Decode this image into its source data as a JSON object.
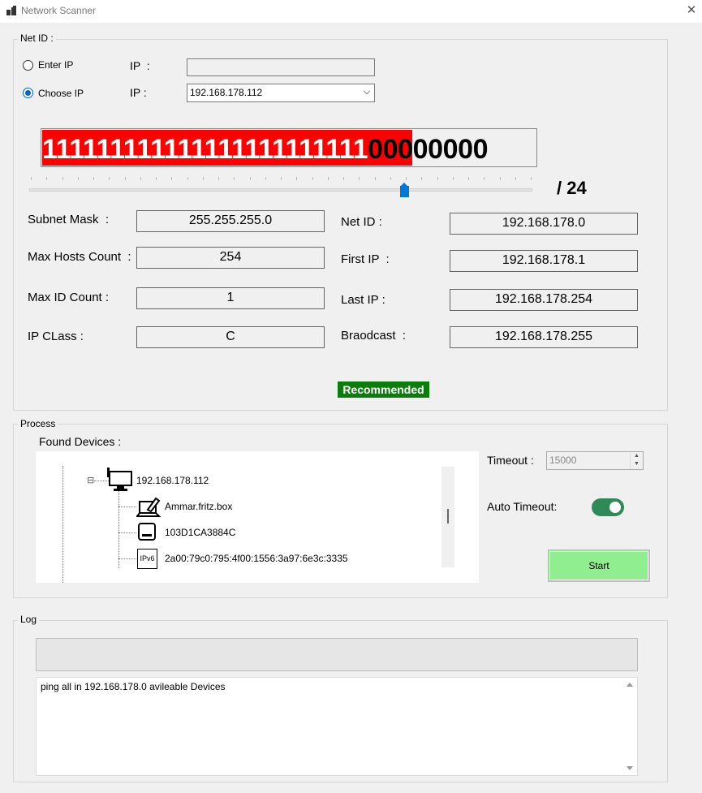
{
  "window": {
    "title": "Network Scanner",
    "close_symbol": "✕"
  },
  "netid_group": {
    "label": "Net ID :",
    "enter_ip": {
      "radio_label": "Enter IP",
      "ip_label": "IP  :",
      "value": "",
      "selected": false
    },
    "choose_ip": {
      "radio_label": "Choose IP",
      "ip_label": "IP :",
      "value": "192.168.178.112",
      "selected": true
    },
    "bits_ones": "111111111111111111111111",
    "bits_zeros": "00000000",
    "prefix": "/ 24",
    "slider_value": 24,
    "slider_max": 32
  },
  "fields_left": [
    {
      "label": "Subnet Mask  :",
      "value": "255.255.255.0"
    },
    {
      "label": "Max Hosts Count  :",
      "value": "254"
    },
    {
      "label": "Max ID Count :",
      "value": "1"
    },
    {
      "label": "IP CLass :",
      "value": "C"
    }
  ],
  "fields_right": [
    {
      "label": "Net ID :",
      "value": "192.168.178.0"
    },
    {
      "label": "First IP  :",
      "value": "192.168.178.1"
    },
    {
      "label": "Last IP :",
      "value": "192.168.178.254"
    },
    {
      "label": "Braodcast  :",
      "value": "192.168.178.255"
    }
  ],
  "recommended_badge": "Recommended",
  "process_group": {
    "label": "Process",
    "found_devices_label": "Found Devices :",
    "tree": {
      "root": {
        "label": "192.168.178.112",
        "icon": "computer-icon",
        "expander": "⊟"
      },
      "children": [
        {
          "label": "Ammar.fritz.box",
          "icon": "laptop-icon"
        },
        {
          "label": "103D1CA3884C",
          "icon": "device-icon"
        },
        {
          "label": "2a00:79c0:795:4f00:1556:3a97:6e3c:3335",
          "icon": "ipv6-icon",
          "icon_text": "IPv6"
        }
      ]
    },
    "timeout_label": "Timeout :",
    "timeout_value": "15000",
    "auto_timeout_label": "Auto Timeout:",
    "auto_timeout_on": true,
    "start_label": "Start"
  },
  "log_group": {
    "label": "Log",
    "text": "ping all in 192.168.178.0 avileable Devices"
  },
  "colors": {
    "bits_fill": "#ff0000",
    "badge": "#0a7d0a",
    "start_button": "#90ee90",
    "toggle_on": "#2e8b57",
    "accent": "#0078d7"
  }
}
